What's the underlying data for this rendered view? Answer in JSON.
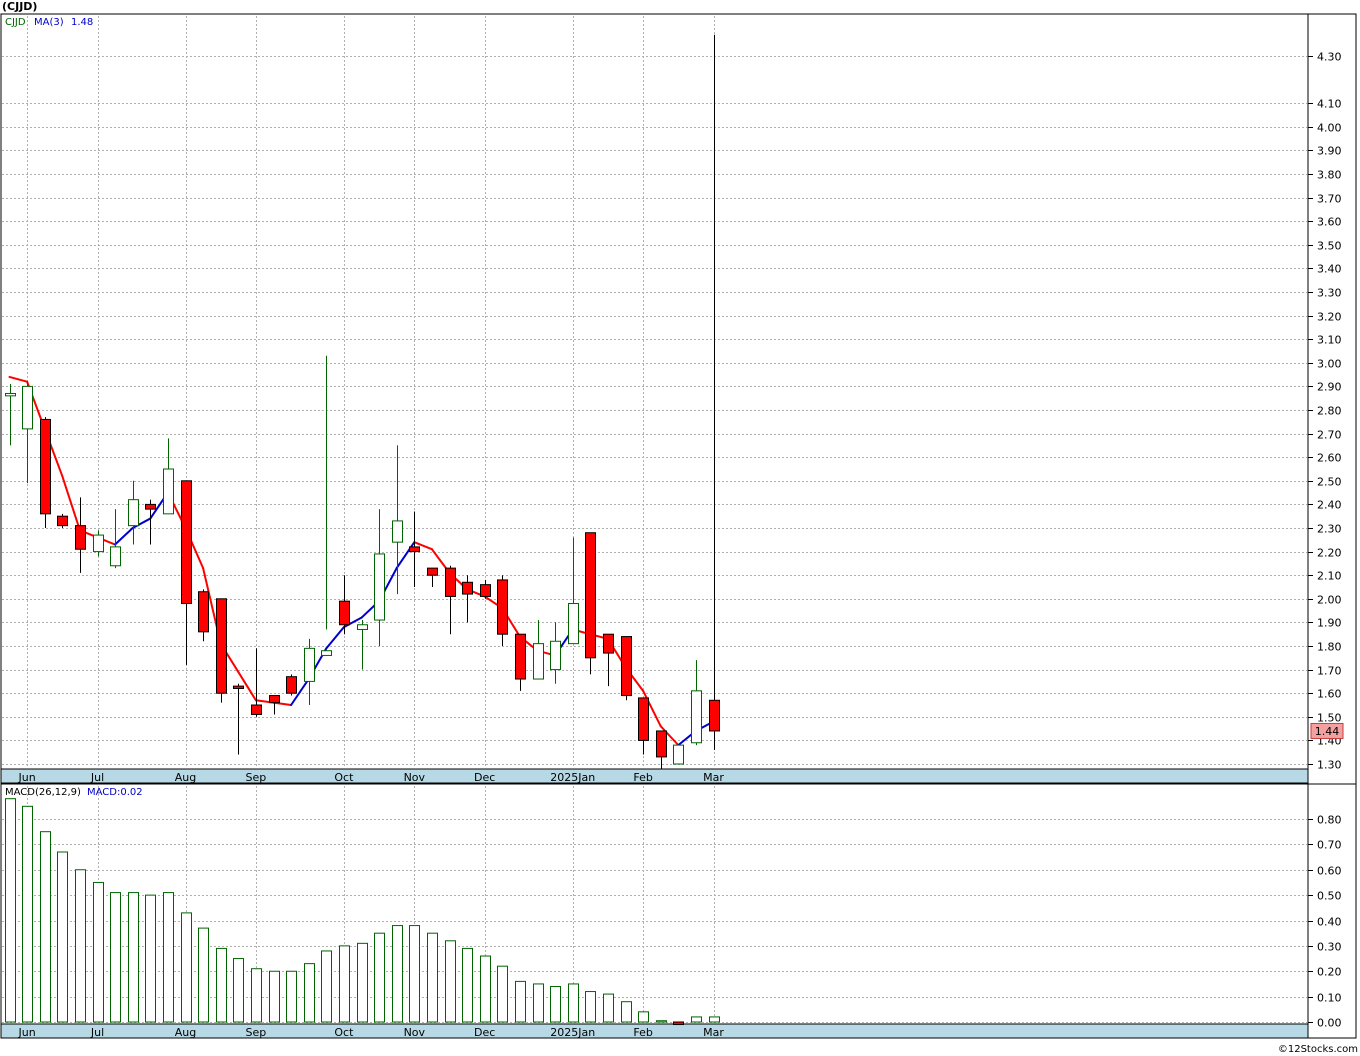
{
  "title": "(CJJD)",
  "credit": "©12Stocks.com",
  "colors": {
    "up": "#006400",
    "down": "#ff0000",
    "ma": "#0000cc",
    "axis_band": "#b7d9e6",
    "grid": "#b0b0b0",
    "price_tag": "#f4a0a0"
  },
  "chart_data": [
    {
      "type": "candlestick",
      "name": "price",
      "legend": {
        "symbol": "CJJD",
        "ma_label": "MA(3)",
        "ma_value": "1.48"
      },
      "current_price_label": "1.44",
      "x_labels": [
        {
          "index": 1,
          "label": "Jun"
        },
        {
          "index": 5,
          "label": "Jul"
        },
        {
          "index": 10,
          "label": "Aug"
        },
        {
          "index": 14,
          "label": "Sep"
        },
        {
          "index": 19,
          "label": "Oct"
        },
        {
          "index": 23,
          "label": "Nov"
        },
        {
          "index": 27,
          "label": "Dec"
        },
        {
          "index": 32,
          "label": "2025Jan"
        },
        {
          "index": 36,
          "label": "Feb"
        },
        {
          "index": 40,
          "label": "Mar"
        }
      ],
      "y_ticks": [
        "1.30",
        "1.40",
        "1.50",
        "1.60",
        "1.70",
        "1.80",
        "1.90",
        "2.00",
        "2.10",
        "2.20",
        "2.30",
        "2.40",
        "2.50",
        "2.60",
        "2.70",
        "2.80",
        "2.90",
        "3.00",
        "3.10",
        "3.20",
        "3.30",
        "3.40",
        "3.50",
        "3.60",
        "3.70",
        "3.80",
        "3.90",
        "4.00",
        "4.10",
        "4.30"
      ],
      "y_range": [
        1.27,
        4.42
      ],
      "candles": [
        {
          "o": 2.86,
          "h": 2.91,
          "l": 2.65,
          "c": 2.87
        },
        {
          "o": 2.72,
          "h": 2.92,
          "l": 2.49,
          "c": 2.9
        },
        {
          "o": 2.76,
          "h": 2.77,
          "l": 2.3,
          "c": 2.36
        },
        {
          "o": 2.35,
          "h": 2.36,
          "l": 2.3,
          "c": 2.31
        },
        {
          "o": 2.31,
          "h": 2.43,
          "l": 2.11,
          "c": 2.21
        },
        {
          "o": 2.2,
          "h": 2.29,
          "l": 2.18,
          "c": 2.27
        },
        {
          "o": 2.14,
          "h": 2.38,
          "l": 2.13,
          "c": 2.22
        },
        {
          "o": 2.31,
          "h": 2.5,
          "l": 2.23,
          "c": 2.42
        },
        {
          "o": 2.4,
          "h": 2.42,
          "l": 2.23,
          "c": 2.38
        },
        {
          "o": 2.36,
          "h": 2.68,
          "l": 2.36,
          "c": 2.55
        },
        {
          "o": 2.5,
          "h": 2.5,
          "l": 1.72,
          "c": 1.98
        },
        {
          "o": 2.03,
          "h": 2.04,
          "l": 1.82,
          "c": 1.86
        },
        {
          "o": 2.0,
          "h": 2.0,
          "l": 1.56,
          "c": 1.6
        },
        {
          "o": 1.63,
          "h": 1.64,
          "l": 1.34,
          "c": 1.62
        },
        {
          "o": 1.55,
          "h": 1.79,
          "l": 1.5,
          "c": 1.51
        },
        {
          "o": 1.59,
          "h": 1.59,
          "l": 1.51,
          "c": 1.56
        },
        {
          "o": 1.67,
          "h": 1.68,
          "l": 1.59,
          "c": 1.6
        },
        {
          "o": 1.65,
          "h": 1.83,
          "l": 1.55,
          "c": 1.79
        },
        {
          "o": 1.76,
          "h": 3.03,
          "l": 1.87,
          "c": 1.78
        },
        {
          "o": 1.99,
          "h": 2.1,
          "l": 1.85,
          "c": 1.89
        },
        {
          "o": 1.87,
          "h": 1.91,
          "l": 1.7,
          "c": 1.89
        },
        {
          "o": 1.91,
          "h": 2.38,
          "l": 1.8,
          "c": 2.19
        },
        {
          "o": 2.24,
          "h": 2.65,
          "l": 2.02,
          "c": 2.33
        },
        {
          "o": 2.22,
          "h": 2.37,
          "l": 2.05,
          "c": 2.2
        },
        {
          "o": 2.13,
          "h": 2.13,
          "l": 2.05,
          "c": 2.1
        },
        {
          "o": 2.13,
          "h": 2.14,
          "l": 1.85,
          "c": 2.01
        },
        {
          "o": 2.07,
          "h": 2.1,
          "l": 1.9,
          "c": 2.02
        },
        {
          "o": 2.06,
          "h": 2.08,
          "l": 2.0,
          "c": 2.01
        },
        {
          "o": 2.08,
          "h": 2.1,
          "l": 1.8,
          "c": 1.85
        },
        {
          "o": 1.85,
          "h": 1.85,
          "l": 1.61,
          "c": 1.66
        },
        {
          "o": 1.66,
          "h": 1.91,
          "l": 1.66,
          "c": 1.81
        },
        {
          "o": 1.7,
          "h": 1.9,
          "l": 1.64,
          "c": 1.82
        },
        {
          "o": 1.81,
          "h": 2.26,
          "l": 1.81,
          "c": 1.98
        },
        {
          "o": 2.28,
          "h": 2.28,
          "l": 1.68,
          "c": 1.75
        },
        {
          "o": 1.85,
          "h": 1.85,
          "l": 1.63,
          "c": 1.77
        },
        {
          "o": 1.84,
          "h": 1.84,
          "l": 1.57,
          "c": 1.59
        },
        {
          "o": 1.58,
          "h": 1.58,
          "l": 1.34,
          "c": 1.4
        },
        {
          "o": 1.44,
          "h": 1.44,
          "l": 1.28,
          "c": 1.33
        },
        {
          "o": 1.3,
          "h": 1.38,
          "l": 1.3,
          "c": 1.38
        },
        {
          "o": 1.39,
          "h": 1.74,
          "l": 1.38,
          "c": 1.61
        },
        {
          "o": 1.57,
          "h": 4.39,
          "l": 1.36,
          "c": 1.44
        }
      ],
      "ma_values": [
        2.94,
        2.92,
        2.72,
        2.52,
        2.29,
        2.26,
        2.23,
        2.3,
        2.34,
        2.45,
        2.3,
        2.13,
        1.81,
        1.69,
        1.57,
        1.56,
        1.55,
        1.66,
        1.79,
        1.88,
        1.92,
        1.99,
        2.13,
        2.24,
        2.21,
        2.11,
        2.04,
        2.01,
        1.96,
        1.84,
        1.78,
        1.76,
        1.87,
        1.85,
        1.83,
        1.71,
        1.61,
        1.46,
        1.38,
        1.44,
        1.48
      ]
    },
    {
      "type": "bar",
      "name": "macd",
      "legend": {
        "label": "MACD(26,12,9)",
        "value_label": "MACD:0.02"
      },
      "y_ticks": [
        "0.00",
        "0.10",
        "0.20",
        "0.30",
        "0.40",
        "0.50",
        "0.60",
        "0.70",
        "0.80"
      ],
      "y_range": [
        -0.01,
        0.88
      ],
      "values": [
        0.88,
        0.85,
        0.75,
        0.67,
        0.6,
        0.55,
        0.51,
        0.51,
        0.5,
        0.51,
        0.43,
        0.37,
        0.29,
        0.25,
        0.21,
        0.2,
        0.2,
        0.23,
        0.28,
        0.3,
        0.31,
        0.35,
        0.38,
        0.38,
        0.35,
        0.32,
        0.29,
        0.26,
        0.22,
        0.16,
        0.15,
        0.14,
        0.15,
        0.12,
        0.11,
        0.08,
        0.04,
        0.005,
        -0.01,
        0.02,
        0.02
      ]
    }
  ]
}
